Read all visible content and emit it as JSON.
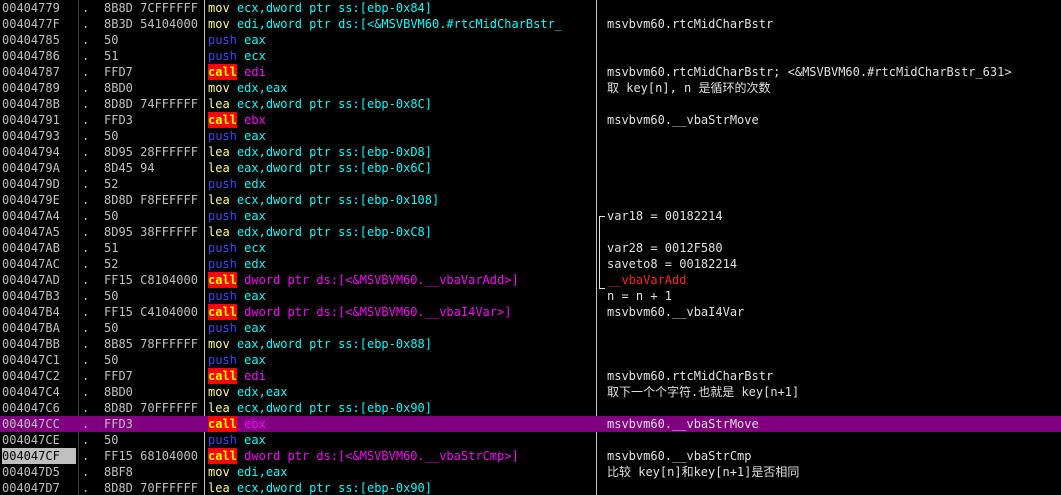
{
  "colors": {
    "background": "#000000",
    "selected_row": "#800080",
    "call_bg": "#ff0000",
    "call_fg": "#ffff00",
    "push_fg": "#4040ff",
    "operand_fg": "#00ffff",
    "call_operand_fg": "#ff00ff",
    "ref_comment_fg": "#ff2020"
  },
  "rows": [
    {
      "addr": "00404779",
      "mark": ".",
      "hex": "8B8D 7CFFFFFF",
      "mn": "mov",
      "ops": "ecx,dword ptr ss:[ebp-0x84]",
      "cmt": ""
    },
    {
      "addr": "0040477F",
      "mark": ".",
      "hex": "8B3D 54104000",
      "mn": "mov",
      "ops": "edi,dword ptr ds:[<&MSVBVM60.#rtcMidCharBstr_",
      "cmt": "msvbvm60.rtcMidCharBstr"
    },
    {
      "addr": "00404785",
      "mark": ".",
      "hex": "50",
      "mn": "push",
      "ops": "eax",
      "cmt": ""
    },
    {
      "addr": "00404786",
      "mark": ".",
      "hex": "51",
      "mn": "push",
      "ops": "ecx",
      "cmt": ""
    },
    {
      "addr": "00404787",
      "mark": ".",
      "hex": "FFD7",
      "mn": "call",
      "ops": "edi",
      "cmt": "msvbvm60.rtcMidCharBstr; <&MSVBVM60.#rtcMidCharBstr_631>"
    },
    {
      "addr": "00404789",
      "mark": ".",
      "hex": "8BD0",
      "mn": "mov",
      "ops": "edx,eax",
      "cmt": "取 key[n], n 是循环的次数"
    },
    {
      "addr": "0040478B",
      "mark": ".",
      "hex": "8D8D 74FFFFFF",
      "mn": "lea",
      "ops": "ecx,dword ptr ss:[ebp-0x8C]",
      "cmt": ""
    },
    {
      "addr": "00404791",
      "mark": ".",
      "hex": "FFD3",
      "mn": "call",
      "ops": "ebx",
      "cmt": "msvbvm60.__vbaStrMove"
    },
    {
      "addr": "00404793",
      "mark": ".",
      "hex": "50",
      "mn": "push",
      "ops": "eax",
      "cmt": ""
    },
    {
      "addr": "00404794",
      "mark": ".",
      "hex": "8D95 28FFFFFF",
      "mn": "lea",
      "ops": "edx,dword ptr ss:[ebp-0xD8]",
      "cmt": ""
    },
    {
      "addr": "0040479A",
      "mark": ".",
      "hex": "8D45 94",
      "mn": "lea",
      "ops": "eax,dword ptr ss:[ebp-0x6C]",
      "cmt": ""
    },
    {
      "addr": "0040479D",
      "mark": ".",
      "hex": "52",
      "mn": "push",
      "ops": "edx",
      "cmt": ""
    },
    {
      "addr": "0040479E",
      "mark": ".",
      "hex": "8D8D F8FEFFFF",
      "mn": "lea",
      "ops": "ecx,dword ptr ss:[ebp-0x108]",
      "cmt": ""
    },
    {
      "addr": "004047A4",
      "mark": ".",
      "hex": "50",
      "mn": "push",
      "ops": "eax",
      "cmt": "var18 = 00182214"
    },
    {
      "addr": "004047A5",
      "mark": ".",
      "hex": "8D95 38FFFFFF",
      "mn": "lea",
      "ops": "edx,dword ptr ss:[ebp-0xC8]",
      "cmt": ""
    },
    {
      "addr": "004047AB",
      "mark": ".",
      "hex": "51",
      "mn": "push",
      "ops": "ecx",
      "cmt": "var28 = 0012F580"
    },
    {
      "addr": "004047AC",
      "mark": ".",
      "hex": "52",
      "mn": "push",
      "ops": "edx",
      "cmt": "saveto8 = 00182214"
    },
    {
      "addr": "004047AD",
      "mark": ".",
      "hex": "FF15 C8104000",
      "mn": "call",
      "ops": "dword ptr ds:[<&MSVBVM60.__vbaVarAdd>]",
      "cmt": "__vbaVarAdd"
    },
    {
      "addr": "004047B3",
      "mark": ".",
      "hex": "50",
      "mn": "push",
      "ops": "eax",
      "cmt": "n = n + 1"
    },
    {
      "addr": "004047B4",
      "mark": ".",
      "hex": "FF15 C4104000",
      "mn": "call",
      "ops": "dword ptr ds:[<&MSVBVM60.__vbaI4Var>]",
      "cmt": "msvbvm60.__vbaI4Var"
    },
    {
      "addr": "004047BA",
      "mark": ".",
      "hex": "50",
      "mn": "push",
      "ops": "eax",
      "cmt": ""
    },
    {
      "addr": "004047BB",
      "mark": ".",
      "hex": "8B85 78FFFFFF",
      "mn": "mov",
      "ops": "eax,dword ptr ss:[ebp-0x88]",
      "cmt": ""
    },
    {
      "addr": "004047C1",
      "mark": ".",
      "hex": "50",
      "mn": "push",
      "ops": "eax",
      "cmt": ""
    },
    {
      "addr": "004047C2",
      "mark": ".",
      "hex": "FFD7",
      "mn": "call",
      "ops": "edi",
      "cmt": "msvbvm60.rtcMidCharBstr"
    },
    {
      "addr": "004047C4",
      "mark": ".",
      "hex": "8BD0",
      "mn": "mov",
      "ops": "edx,eax",
      "cmt": "取下一个个字符.也就是 key[n+1]"
    },
    {
      "addr": "004047C6",
      "mark": ".",
      "hex": "8D8D 70FFFFFF",
      "mn": "lea",
      "ops": "ecx,dword ptr ss:[ebp-0x90]",
      "cmt": ""
    },
    {
      "addr": "004047CC",
      "mark": ".",
      "hex": "FFD3",
      "mn": "call",
      "ops": "ebx",
      "cmt": "msvbvm60.__vbaStrMove"
    },
    {
      "addr": "004047CE",
      "mark": ".",
      "hex": "50",
      "mn": "push",
      "ops": "eax",
      "cmt": ""
    },
    {
      "addr": "004047CF",
      "mark": ".",
      "hex": "FF15 68104000",
      "mn": "call",
      "ops": "dword ptr ds:[<&MSVBVM60.__vbaStrCmp>]",
      "cmt": "msvbvm60.__vbaStrCmp"
    },
    {
      "addr": "004047D5",
      "mark": ".",
      "hex": "8BF8",
      "mn": "mov",
      "ops": "edi,eax",
      "cmt": "比较 key[n]和key[n+1]是否相同"
    },
    {
      "addr": "004047D7",
      "mark": ".",
      "hex": "8D8D 70FFFFFF",
      "mn": "lea",
      "ops": "ecx,dword ptr ss:[ebp-0x90]",
      "cmt": ""
    }
  ],
  "selected_row": "004047CC",
  "current_eip_row": "004047CF",
  "ref_comment_row": "004047AD"
}
